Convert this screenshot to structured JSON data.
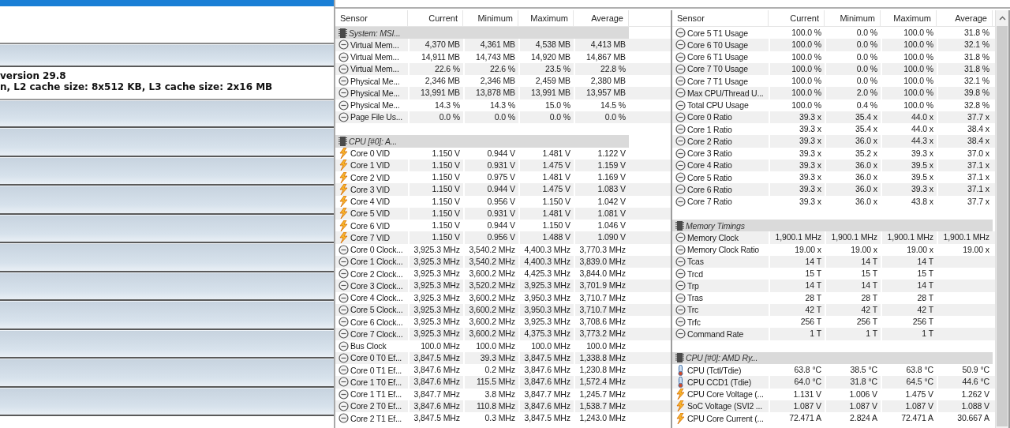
{
  "background_window": {
    "info_lines": [
      "version 29.8",
      "n, L2 cache size: 8x512 KB, L3 cache size: 2x16 MB"
    ]
  },
  "sensor_window": {
    "panes": [
      {
        "columns": [
          "Sensor",
          "Current",
          "Minimum",
          "Maximum",
          "Average"
        ],
        "rows": [
          {
            "kind": "group",
            "label": "System: MSI..."
          },
          {
            "kind": "clock",
            "cells": [
              "Virtual Mem...",
              "4,370 MB",
              "4,361 MB",
              "4,538 MB",
              "4,413 MB"
            ]
          },
          {
            "kind": "clock",
            "cells": [
              "Virtual Mem...",
              "14,911 MB",
              "14,743 MB",
              "14,920 MB",
              "14,867 MB"
            ]
          },
          {
            "kind": "clock",
            "cells": [
              "Virtual Mem...",
              "22.6 %",
              "22.6 %",
              "23.5 %",
              "22.8 %"
            ]
          },
          {
            "kind": "clock",
            "cells": [
              "Physical Me...",
              "2,346 MB",
              "2,346 MB",
              "2,459 MB",
              "2,380 MB"
            ]
          },
          {
            "kind": "clock",
            "cells": [
              "Physical Me...",
              "13,991 MB",
              "13,878 MB",
              "13,991 MB",
              "13,957 MB"
            ]
          },
          {
            "kind": "clock",
            "cells": [
              "Physical Me...",
              "14.3 %",
              "14.3 %",
              "15.0 %",
              "14.5 %"
            ]
          },
          {
            "kind": "clock",
            "cells": [
              "Page File Us...",
              "0.0 %",
              "0.0 %",
              "0.0 %",
              "0.0 %"
            ]
          },
          {
            "kind": "blank"
          },
          {
            "kind": "group",
            "label": "CPU [#0]: A..."
          },
          {
            "kind": "voltage",
            "cells": [
              "Core 0 VID",
              "1.150 V",
              "0.944 V",
              "1.481 V",
              "1.122 V"
            ]
          },
          {
            "kind": "voltage",
            "cells": [
              "Core 1 VID",
              "1.150 V",
              "0.931 V",
              "1.475 V",
              "1.159 V"
            ]
          },
          {
            "kind": "voltage",
            "cells": [
              "Core 2 VID",
              "1.150 V",
              "0.975 V",
              "1.481 V",
              "1.169 V"
            ]
          },
          {
            "kind": "voltage",
            "cells": [
              "Core 3 VID",
              "1.150 V",
              "0.944 V",
              "1.475 V",
              "1.083 V"
            ]
          },
          {
            "kind": "voltage",
            "cells": [
              "Core 4 VID",
              "1.150 V",
              "0.956 V",
              "1.150 V",
              "1.042 V"
            ]
          },
          {
            "kind": "voltage",
            "cells": [
              "Core 5 VID",
              "1.150 V",
              "0.931 V",
              "1.481 V",
              "1.081 V"
            ]
          },
          {
            "kind": "voltage",
            "cells": [
              "Core 6 VID",
              "1.150 V",
              "0.944 V",
              "1.150 V",
              "1.046 V"
            ]
          },
          {
            "kind": "voltage",
            "cells": [
              "Core 7 VID",
              "1.150 V",
              "0.956 V",
              "1.488 V",
              "1.090 V"
            ]
          },
          {
            "kind": "clock",
            "cells": [
              "Core 0 Clock...",
              "3,925.3 MHz",
              "3,540.2 MHz",
              "4,400.3 MHz",
              "3,770.3 MHz"
            ]
          },
          {
            "kind": "clock",
            "cells": [
              "Core 1 Clock...",
              "3,925.3 MHz",
              "3,540.2 MHz",
              "4,400.3 MHz",
              "3,839.0 MHz"
            ]
          },
          {
            "kind": "clock",
            "cells": [
              "Core 2 Clock...",
              "3,925.3 MHz",
              "3,600.2 MHz",
              "4,425.3 MHz",
              "3,844.0 MHz"
            ]
          },
          {
            "kind": "clock",
            "cells": [
              "Core 3 Clock...",
              "3,925.3 MHz",
              "3,520.2 MHz",
              "3,925.3 MHz",
              "3,701.9 MHz"
            ]
          },
          {
            "kind": "clock",
            "cells": [
              "Core 4 Clock...",
              "3,925.3 MHz",
              "3,600.2 MHz",
              "3,950.3 MHz",
              "3,710.7 MHz"
            ]
          },
          {
            "kind": "clock",
            "cells": [
              "Core 5 Clock...",
              "3,925.3 MHz",
              "3,600.2 MHz",
              "3,950.3 MHz",
              "3,710.7 MHz"
            ]
          },
          {
            "kind": "clock",
            "cells": [
              "Core 6 Clock...",
              "3,925.3 MHz",
              "3,600.2 MHz",
              "3,925.3 MHz",
              "3,708.6 MHz"
            ]
          },
          {
            "kind": "clock",
            "cells": [
              "Core 7 Clock...",
              "3,925.3 MHz",
              "3,600.2 MHz",
              "4,375.3 MHz",
              "3,773.2 MHz"
            ]
          },
          {
            "kind": "clock",
            "cells": [
              "Bus Clock",
              "100.0 MHz",
              "100.0 MHz",
              "100.0 MHz",
              "100.0 MHz"
            ]
          },
          {
            "kind": "clock",
            "cells": [
              "Core 0 T0 Ef...",
              "3,847.5 MHz",
              "39.3 MHz",
              "3,847.5 MHz",
              "1,338.8 MHz"
            ]
          },
          {
            "kind": "clock",
            "cells": [
              "Core 0 T1 Ef...",
              "3,847.6 MHz",
              "0.2 MHz",
              "3,847.6 MHz",
              "1,230.8 MHz"
            ]
          },
          {
            "kind": "clock",
            "cells": [
              "Core 1 T0 Ef...",
              "3,847.6 MHz",
              "115.5 MHz",
              "3,847.6 MHz",
              "1,572.4 MHz"
            ]
          },
          {
            "kind": "clock",
            "cells": [
              "Core 1 T1 Ef...",
              "3,847.7 MHz",
              "3.8 MHz",
              "3,847.7 MHz",
              "1,245.7 MHz"
            ]
          },
          {
            "kind": "clock",
            "cells": [
              "Core 2 T0 Ef...",
              "3,847.6 MHz",
              "110.8 MHz",
              "3,847.6 MHz",
              "1,538.7 MHz"
            ]
          },
          {
            "kind": "clock",
            "cells": [
              "Core 2 T1 Ef...",
              "3,847.5 MHz",
              "0.3 MHz",
              "3,847.5 MHz",
              "1,243.0 MHz"
            ]
          }
        ]
      },
      {
        "columns": [
          "Sensor",
          "Current",
          "Minimum",
          "Maximum",
          "Average"
        ],
        "rows": [
          {
            "kind": "clock",
            "cells": [
              "Core 5 T1 Usage",
              "100.0 %",
              "0.0 %",
              "100.0 %",
              "31.8 %"
            ]
          },
          {
            "kind": "clock",
            "cells": [
              "Core 6 T0 Usage",
              "100.0 %",
              "0.0 %",
              "100.0 %",
              "32.1 %"
            ]
          },
          {
            "kind": "clock",
            "cells": [
              "Core 6 T1 Usage",
              "100.0 %",
              "0.0 %",
              "100.0 %",
              "31.8 %"
            ]
          },
          {
            "kind": "clock",
            "cells": [
              "Core 7 T0 Usage",
              "100.0 %",
              "0.0 %",
              "100.0 %",
              "31.8 %"
            ]
          },
          {
            "kind": "clock",
            "cells": [
              "Core 7 T1 Usage",
              "100.0 %",
              "0.0 %",
              "100.0 %",
              "32.1 %"
            ]
          },
          {
            "kind": "clock",
            "cells": [
              "Max CPU/Thread U...",
              "100.0 %",
              "2.0 %",
              "100.0 %",
              "39.8 %"
            ]
          },
          {
            "kind": "clock",
            "cells": [
              "Total CPU Usage",
              "100.0 %",
              "0.4 %",
              "100.0 %",
              "32.8 %"
            ]
          },
          {
            "kind": "clock",
            "cells": [
              "Core 0 Ratio",
              "39.3 x",
              "35.4 x",
              "44.0 x",
              "37.7 x"
            ]
          },
          {
            "kind": "clock",
            "cells": [
              "Core 1 Ratio",
              "39.3 x",
              "35.4 x",
              "44.0 x",
              "38.4 x"
            ]
          },
          {
            "kind": "clock",
            "cells": [
              "Core 2 Ratio",
              "39.3 x",
              "36.0 x",
              "44.3 x",
              "38.4 x"
            ]
          },
          {
            "kind": "clock",
            "cells": [
              "Core 3 Ratio",
              "39.3 x",
              "35.2 x",
              "39.3 x",
              "37.0 x"
            ]
          },
          {
            "kind": "clock",
            "cells": [
              "Core 4 Ratio",
              "39.3 x",
              "36.0 x",
              "39.5 x",
              "37.1 x"
            ]
          },
          {
            "kind": "clock",
            "cells": [
              "Core 5 Ratio",
              "39.3 x",
              "36.0 x",
              "39.5 x",
              "37.1 x"
            ]
          },
          {
            "kind": "clock",
            "cells": [
              "Core 6 Ratio",
              "39.3 x",
              "36.0 x",
              "39.3 x",
              "37.1 x"
            ]
          },
          {
            "kind": "clock",
            "cells": [
              "Core 7 Ratio",
              "39.3 x",
              "36.0 x",
              "43.8 x",
              "37.7 x"
            ]
          },
          {
            "kind": "blank"
          },
          {
            "kind": "group",
            "label": "Memory Timings"
          },
          {
            "kind": "clock",
            "cells": [
              "Memory Clock",
              "1,900.1 MHz",
              "1,900.1 MHz",
              "1,900.1 MHz",
              "1,900.1 MHz"
            ]
          },
          {
            "kind": "clock",
            "cells": [
              "Memory Clock Ratio",
              "19.00 x",
              "19.00 x",
              "19.00 x",
              "19.00 x"
            ]
          },
          {
            "kind": "clock",
            "cells": [
              "Tcas",
              "14 T",
              "14 T",
              "14 T"
            ]
          },
          {
            "kind": "clock",
            "cells": [
              "Trcd",
              "15 T",
              "15 T",
              "15 T"
            ]
          },
          {
            "kind": "clock",
            "cells": [
              "Trp",
              "14 T",
              "14 T",
              "14 T"
            ]
          },
          {
            "kind": "clock",
            "cells": [
              "Tras",
              "28 T",
              "28 T",
              "28 T"
            ]
          },
          {
            "kind": "clock",
            "cells": [
              "Trc",
              "42 T",
              "42 T",
              "42 T"
            ]
          },
          {
            "kind": "clock",
            "cells": [
              "Trfc",
              "256 T",
              "256 T",
              "256 T"
            ]
          },
          {
            "kind": "clock",
            "cells": [
              "Command Rate",
              "1 T",
              "1 T",
              "1 T"
            ]
          },
          {
            "kind": "blank"
          },
          {
            "kind": "group",
            "label": "CPU [#0]: AMD Ry..."
          },
          {
            "kind": "temperature",
            "cells": [
              "CPU (Tctl/Tdie)",
              "63.8 °C",
              "38.5 °C",
              "63.8 °C",
              "50.9 °C"
            ]
          },
          {
            "kind": "temperature",
            "cells": [
              "CPU CCD1 (Tdie)",
              "64.0 °C",
              "31.8 °C",
              "64.5 °C",
              "44.6 °C"
            ]
          },
          {
            "kind": "voltage",
            "cells": [
              "CPU Core Voltage (...",
              "1.131 V",
              "1.006 V",
              "1.475 V",
              "1.262 V"
            ]
          },
          {
            "kind": "voltage",
            "cells": [
              "SoC Voltage (SVI2 ...",
              "1.087 V",
              "1.087 V",
              "1.087 V",
              "1.088 V"
            ]
          },
          {
            "kind": "voltage",
            "cells": [
              "CPU Core Current (...",
              "72.471 A",
              "2.824 A",
              "72.471 A",
              "30.667 A"
            ]
          }
        ]
      }
    ]
  }
}
